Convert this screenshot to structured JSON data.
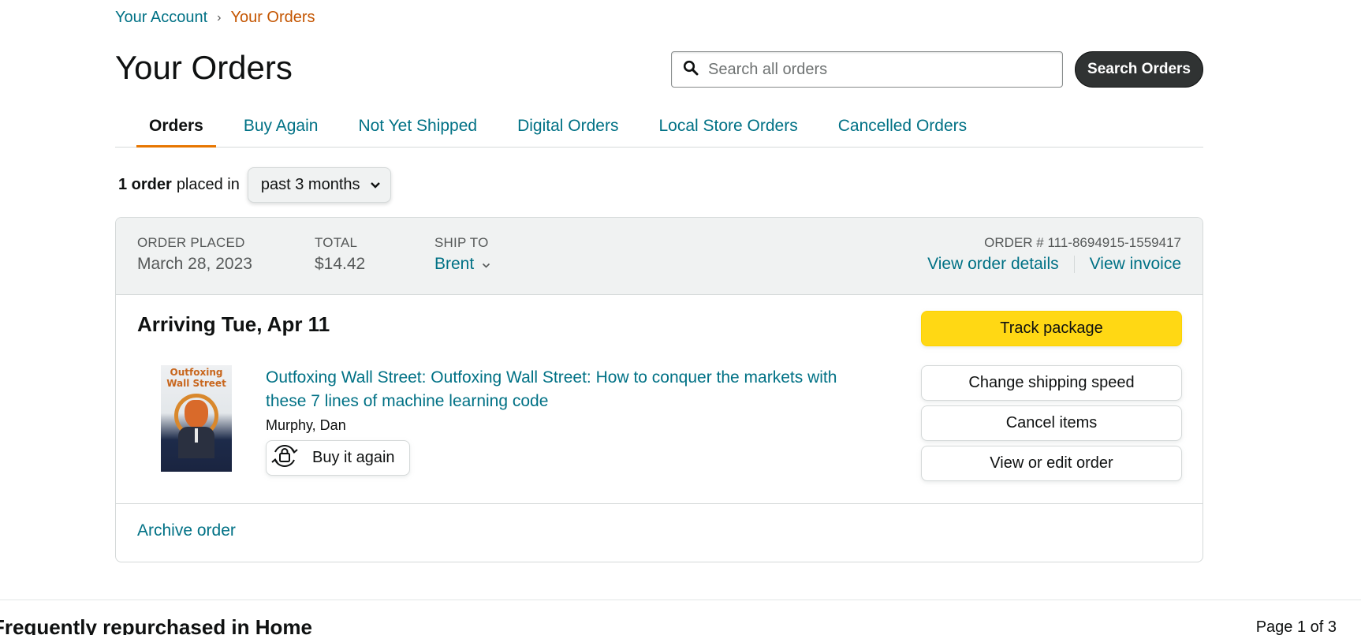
{
  "breadcrumb": {
    "account": "Your Account",
    "separator": "›",
    "current": "Your Orders"
  },
  "page_title": "Your Orders",
  "search": {
    "placeholder": "Search all orders",
    "button": "Search Orders"
  },
  "tabs": [
    {
      "label": "Orders",
      "active": true
    },
    {
      "label": "Buy Again"
    },
    {
      "label": "Not Yet Shipped"
    },
    {
      "label": "Digital Orders"
    },
    {
      "label": "Local Store Orders"
    },
    {
      "label": "Cancelled Orders"
    }
  ],
  "filter": {
    "count": "1 order",
    "placed_in": "placed in",
    "period": "past 3 months"
  },
  "order": {
    "placed_label": "ORDER PLACED",
    "placed_value": "March 28, 2023",
    "total_label": "TOTAL",
    "total_value": "$14.42",
    "ship_label": "SHIP TO",
    "ship_value": "Brent",
    "order_number": "ORDER # 111-8694915-1559417",
    "view_details": "View order details",
    "view_invoice": "View invoice",
    "arrival": "Arriving Tue, Apr 11",
    "product": {
      "cover_title": "Outfoxing Wall Street",
      "title": "Outfoxing Wall Street: Outfoxing Wall Street: How to conquer the markets with these 7 lines of machine learning code",
      "author": "Murphy, Dan",
      "buy_again": "Buy it again"
    },
    "actions": {
      "track": "Track package",
      "change_speed": "Change shipping speed",
      "cancel": "Cancel items",
      "view_edit": "View or edit order"
    },
    "archive": "Archive order"
  },
  "bottom": {
    "title": "Frequently repurchased in Home",
    "page": "Page 1 of 3"
  },
  "colors": {
    "link": "#007185",
    "accent": "#e77600",
    "track_button": "#ffd814",
    "breadcrumb_current": "#c45500"
  }
}
